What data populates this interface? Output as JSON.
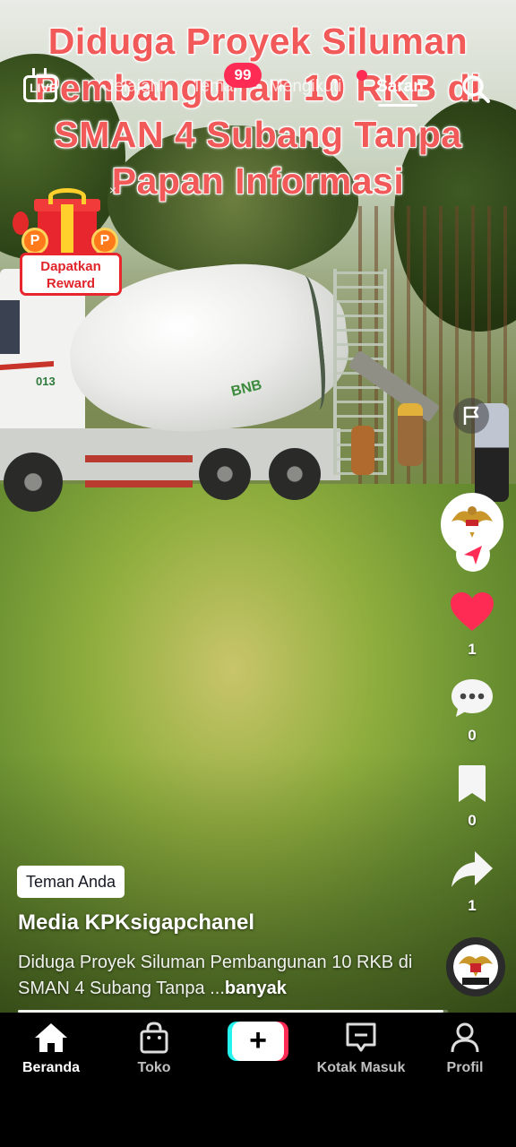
{
  "video": {
    "headline": "Diduga Proyek Siluman Pembangunan 10 RKB di SMAN 4 Subang Tanpa Papan Informasi",
    "truck_number": "013",
    "drum_logo": "BNB"
  },
  "top_nav": {
    "live_label": "LIVE",
    "tabs": [
      {
        "label": "Jelajahi"
      },
      {
        "label": "Teman"
      },
      {
        "label": "Mengikuti"
      },
      {
        "label": "Saran"
      }
    ],
    "active_tab": "Saran",
    "friends_badge": "99"
  },
  "reward": {
    "label_line1": "Dapatkan",
    "label_line2": "Reward",
    "close": "×",
    "coin_symbol": "P"
  },
  "actions": {
    "likes": "1",
    "comments": "0",
    "saves": "0",
    "shares": "1",
    "like_color": "#fe2c55"
  },
  "post": {
    "friend_tag": "Teman Anda",
    "username": "Media KPKsigapchanel",
    "caption": "Diduga Proyek Siluman Pembangunan 10 RKB di SMAN 4 Subang Tanpa ...",
    "more": "banyak",
    "progress": 0.99
  },
  "tabbar": {
    "home": "Beranda",
    "shop": "Toko",
    "create": "+",
    "inbox": "Kotak Masuk",
    "profile": "Profil"
  }
}
